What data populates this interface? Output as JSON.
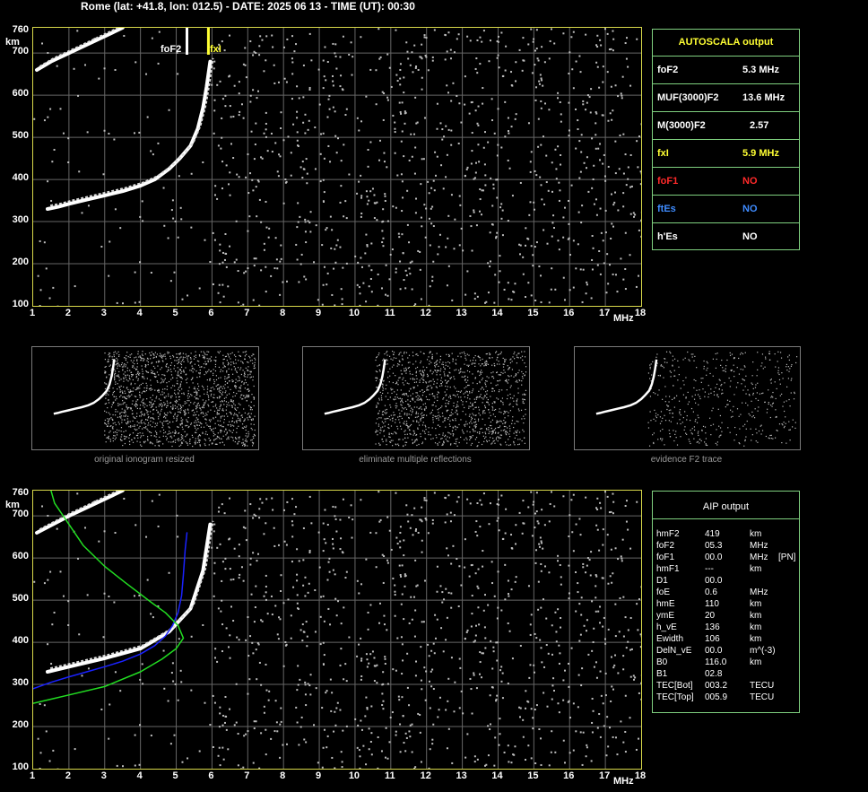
{
  "header": {
    "title": "Rome (lat: +41.8, lon: 012.5) - DATE: 2025 06 13 - TIME (UT): 00:30"
  },
  "colors": {
    "frame": "#d8d84a",
    "grid": "#666666",
    "panel_border": "#7fd07f",
    "autoscala_title": "#ffff33",
    "fxI": "#ffff33",
    "foF1": "#ff2a2a",
    "ftEs": "#3f8cff",
    "model_green": "#22dd22",
    "model_blue": "#1a22ff"
  },
  "ionogram_axes": {
    "y_unit": "km",
    "y_ticks": [
      "760",
      "700",
      "600",
      "500",
      "400",
      "300",
      "200",
      "100"
    ],
    "x_ticks": [
      "1",
      "2",
      "3",
      "4",
      "5",
      "6",
      "7",
      "8",
      "9",
      "10",
      "11",
      "12",
      "13",
      "14",
      "15",
      "16",
      "17",
      "18"
    ],
    "x_unit": "MHz"
  },
  "top_markers": {
    "foF2_label": "foF2",
    "fxI_label": "fxI"
  },
  "thumbnails": [
    {
      "caption": "original ionogram resized"
    },
    {
      "caption": "eliminate multiple reflections"
    },
    {
      "caption": "evidence F2 trace"
    }
  ],
  "autoscala": {
    "title": "AUTOSCALA output",
    "rows": [
      {
        "name": "foF2",
        "value": "5.3 MHz",
        "color": "#ffffff"
      },
      {
        "name": "MUF(3000)F2",
        "value": "13.6 MHz",
        "color": "#ffffff"
      },
      {
        "name": "M(3000)F2",
        "value": "2.57",
        "color": "#ffffff"
      },
      {
        "name": "fxI",
        "value": "5.9 MHz",
        "color": "#ffff33"
      },
      {
        "name": "foF1",
        "value": "NO",
        "color": "#ff2a2a"
      },
      {
        "name": "ftEs",
        "value": "NO",
        "color": "#3f8cff"
      },
      {
        "name": "h'Es",
        "value": "NO",
        "color": "#ffffff"
      }
    ]
  },
  "aip": {
    "title": "AIP output",
    "rows": [
      {
        "name": "hmF2",
        "value": "419",
        "unit": "km",
        "note": ""
      },
      {
        "name": "foF2",
        "value": "05.3",
        "unit": "MHz",
        "note": ""
      },
      {
        "name": "foF1",
        "value": "00.0",
        "unit": "MHz",
        "note": "[PN]"
      },
      {
        "name": "hmF1",
        "value": "---",
        "unit": "km",
        "note": ""
      },
      {
        "name": "D1",
        "value": "00.0",
        "unit": "",
        "note": ""
      },
      {
        "name": "foE",
        "value": "0.6",
        "unit": "MHz",
        "note": ""
      },
      {
        "name": "hmE",
        "value": "110",
        "unit": "km",
        "note": ""
      },
      {
        "name": "ymE",
        "value": "20",
        "unit": "km",
        "note": ""
      },
      {
        "name": "h_vE",
        "value": "136",
        "unit": "km",
        "note": ""
      },
      {
        "name": "Ewidth",
        "value": "106",
        "unit": "km",
        "note": ""
      },
      {
        "name": "DelN_vE",
        "value": "00.0",
        "unit": "m^(-3)",
        "note": ""
      },
      {
        "name": "B0",
        "value": "116.0",
        "unit": "km",
        "note": ""
      },
      {
        "name": "B1",
        "value": "02.8",
        "unit": "",
        "note": ""
      },
      {
        "name": "TEC[Bot]",
        "value": "003.2",
        "unit": "TECU",
        "note": ""
      },
      {
        "name": "TEC[Top]",
        "value": "005.9",
        "unit": "TECU",
        "note": ""
      }
    ]
  },
  "chart_data": [
    {
      "type": "scatter",
      "xlim": [
        1,
        18
      ],
      "ylim": [
        100,
        760
      ],
      "grid": true,
      "series": [
        {
          "name": "",
          "color": "#ffffff",
          "points": [
            [
              1.4,
              330
            ],
            [
              1.7,
              335
            ],
            [
              2.0,
              342
            ],
            [
              2.5,
              352
            ],
            [
              3.0,
              362
            ],
            [
              3.5,
              372
            ],
            [
              4.0,
              385
            ],
            [
              4.4,
              400
            ],
            [
              4.8,
              425
            ],
            [
              5.1,
              450
            ],
            [
              5.4,
              480
            ],
            [
              5.6,
              520
            ],
            [
              5.75,
              570
            ],
            [
              5.85,
              620
            ],
            [
              5.95,
              680
            ]
          ]
        },
        {
          "name": "",
          "color": "#ffffff",
          "points": [
            [
              1.1,
              660
            ],
            [
              1.5,
              680
            ],
            [
              2.0,
              700
            ],
            [
              2.5,
              720
            ],
            [
              3.0,
              740
            ],
            [
              3.5,
              760
            ]
          ]
        }
      ],
      "markers": [
        {
          "label": "foF2",
          "x": 5.3
        },
        {
          "label": "fxI",
          "x": 5.9
        }
      ]
    },
    {
      "type": "line",
      "xlim": [
        1,
        18
      ],
      "ylim": [
        100,
        760
      ],
      "grid": true,
      "series": [
        {
          "name": "",
          "color": "#ffffff",
          "points": [
            [
              1.4,
              330
            ],
            [
              2.0,
              342
            ],
            [
              3.0,
              362
            ],
            [
              4.0,
              385
            ],
            [
              4.8,
              425
            ],
            [
              5.4,
              480
            ],
            [
              5.75,
              570
            ],
            [
              5.95,
              680
            ]
          ]
        },
        {
          "name": "",
          "color": "#ffffff",
          "points": [
            [
              1.1,
              660
            ],
            [
              2.0,
              700
            ],
            [
              3.0,
              740
            ],
            [
              3.5,
              760
            ]
          ]
        },
        {
          "name": "",
          "color": "#1a22ff",
          "points": [
            [
              1.0,
              290
            ],
            [
              1.5,
              305
            ],
            [
              2.0,
              318
            ],
            [
              2.5,
              330
            ],
            [
              3.0,
              342
            ],
            [
              3.5,
              355
            ],
            [
              4.0,
              372
            ],
            [
              4.4,
              392
            ],
            [
              4.7,
              415
            ],
            [
              4.9,
              440
            ],
            [
              5.05,
              470
            ],
            [
              5.15,
              510
            ],
            [
              5.2,
              560
            ],
            [
              5.25,
              620
            ],
            [
              5.3,
              660
            ]
          ]
        },
        {
          "name": "",
          "color": "#22dd22",
          "points": [
            [
              1.0,
              255
            ],
            [
              1.5,
              265
            ],
            [
              2.0,
              275
            ],
            [
              3.0,
              295
            ],
            [
              4.0,
              330
            ],
            [
              4.6,
              360
            ],
            [
              5.0,
              385
            ],
            [
              5.2,
              410
            ],
            [
              5.05,
              440
            ],
            [
              4.7,
              470
            ],
            [
              4.3,
              495
            ],
            [
              3.6,
              540
            ],
            [
              3.0,
              580
            ],
            [
              2.4,
              630
            ],
            [
              2.0,
              680
            ],
            [
              1.6,
              730
            ],
            [
              1.5,
              760
            ]
          ]
        }
      ]
    }
  ]
}
